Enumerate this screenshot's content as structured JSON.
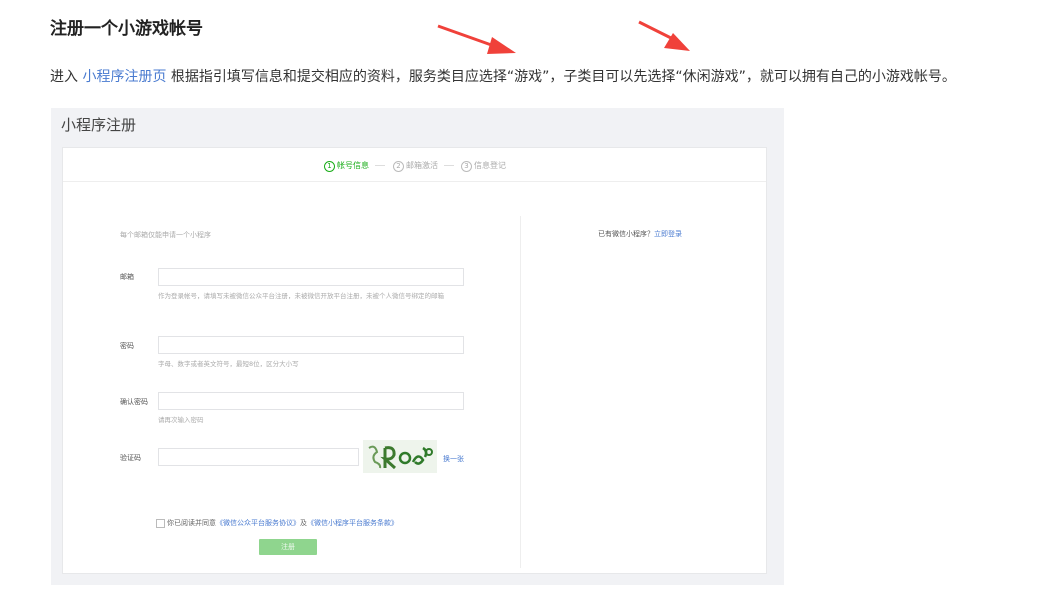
{
  "doc": {
    "title": "注册一个小游戏帐号",
    "intro": {
      "prefix": "进入 ",
      "link": "小程序注册页",
      "suffix": " 根据指引填写信息和提交相应的资料，服务类目应选择“游戏”，子类目可以先选择“休闲游戏”，就可以拥有自己的小游戏帐号。"
    }
  },
  "screenshot": {
    "title": "小程序注册",
    "steps": [
      {
        "num": "1",
        "label": "帐号信息",
        "active": true
      },
      {
        "num": "2",
        "label": "邮箱激活",
        "active": false
      },
      {
        "num": "3",
        "label": "信息登记",
        "active": false
      }
    ],
    "form": {
      "note": "每个邮箱仅能申请一个小程序",
      "email_label": "邮箱",
      "email_hint": "作为登录帐号，请填写未被微信公众平台注册，未被微信开放平台注册，未被个人微信号绑定的邮箱",
      "password_label": "密码",
      "password_hint": "字母、数字或者英文符号，最短8位，区分大小写",
      "confirm_label": "确认密码",
      "confirm_hint": "请再次输入密码",
      "captcha_label": "验证码",
      "captcha_refresh": "换一张",
      "agree_prefix": "你已阅读并同意",
      "agree_link1": "《微信公众平台服务协议》",
      "agree_mid": "及",
      "agree_link2": "《微信小程序平台服务条款》",
      "submit_label": "注册"
    },
    "side": {
      "question": "已有微信小程序？",
      "login_link": "立即登录"
    }
  },
  "colors": {
    "accent": "#1aad19",
    "link": "#4a7bd0",
    "arrow": "#f0413a"
  }
}
